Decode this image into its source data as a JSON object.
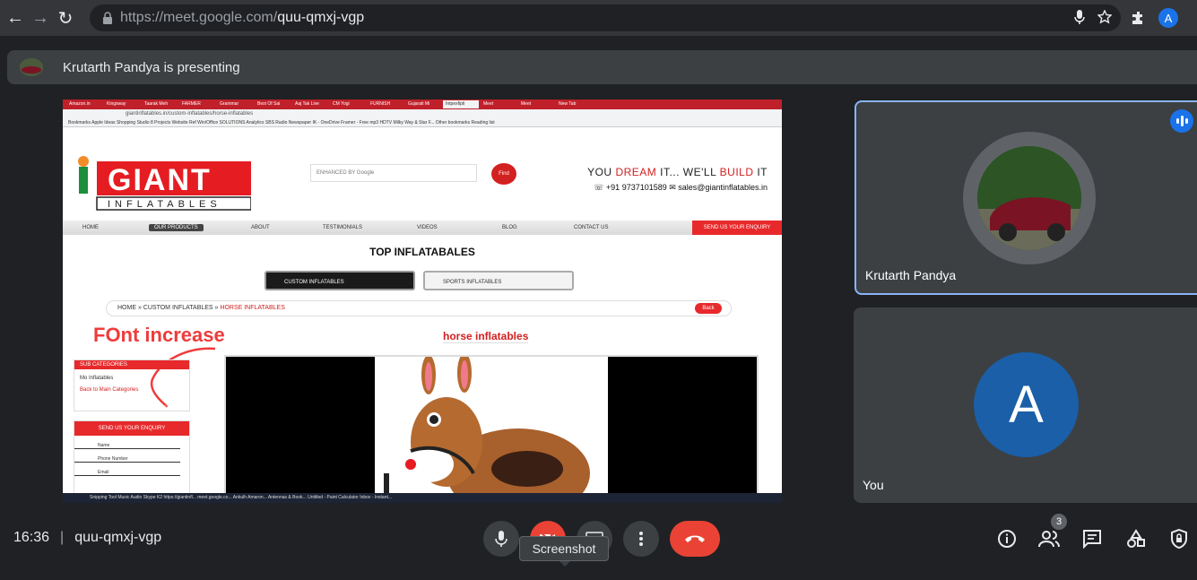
{
  "browser": {
    "url_host": "https://meet.google.com/",
    "url_path": "quu-qmxj-vgp",
    "profile_initial": "A"
  },
  "presenting_bar": {
    "text": "Krutarth Pandya is presenting"
  },
  "shared_screen": {
    "tabs": [
      "Amazon.in",
      "Kingsway",
      "Taarak Meh",
      "FARMER",
      "Grammar",
      "Best Of Sai",
      "Aaj Tak Live",
      "CM Yogi",
      "FURNISH",
      "Gujarati Mi",
      "Intpexfipti",
      "Meet",
      "Meet",
      "New Tab"
    ],
    "address": "giantinflatables.in/custom-inflatables/horse-inflatables",
    "bookmarks": "Bookmarks   Apple   Ideas   Shopping   Studio 8 Projects   Website Ref   Win/Office   SOLUTIONS   Analytics   SBS Radio   Newspaper   IK - OneDrive   Framer - Free mp3   HDTV   Milky Way & Star F...     Other bookmarks   Reading list",
    "site": {
      "logo_top": "GIANT",
      "logo_bottom": "INFLATABLES",
      "search_placeholder": "ENHANCED BY Google",
      "find_label": "Find",
      "tagline_a": "YOU ",
      "tagline_b": "DREAM",
      "tagline_c": " IT... WE'LL ",
      "tagline_d": "BUILD",
      "tagline_e": " IT",
      "phone": "+91 9737101589",
      "email": "sales@giantinflatables.in",
      "nav": [
        "HOME",
        "OUR PRODUCTS",
        "ABOUT",
        "TESTIMONIALS",
        "VIDEOS",
        "BLOG",
        "CONTACT US"
      ],
      "enquiry": "SEND US YOUR ENQUIRY",
      "section_title": "TOP INFLATABALES",
      "pill_custom": "CUSTOM INFLATABLES",
      "pill_sports": "SPORTS INFLATABLES",
      "crumb_home": "HOME",
      "crumb_custom": "CUSTOM INFLATABLES",
      "crumb_horse": "HORSE INFLATABLES",
      "back": "Back",
      "annotation": "FOnt increase",
      "page_heading": "horse inflatables",
      "subcat_header": "SUB CATEGORIES",
      "subcat_item": "Mo Inflatables",
      "subcat_back": "Back to Main Categories",
      "enq_header": "SEND US YOUR ENQUIRY",
      "field_name": "Name",
      "field_phone": "Phone Number",
      "field_email": "Email"
    },
    "taskbar": "Snipping Tool    Music Audio    Skype    K2    https://giantinfl...   meet.google.co...   Ankulh Amaron...   Antennas & Book...   Untitled - Paint    Calculator    Inbox - Instant..."
  },
  "tiles": [
    {
      "name": "Krutarth Pandya"
    },
    {
      "name": "You",
      "initial": "A"
    }
  ],
  "meeting": {
    "time": "16:36",
    "code": "quu-qmxj-vgp"
  },
  "tooltip": "Screenshot",
  "participants_count": "3"
}
